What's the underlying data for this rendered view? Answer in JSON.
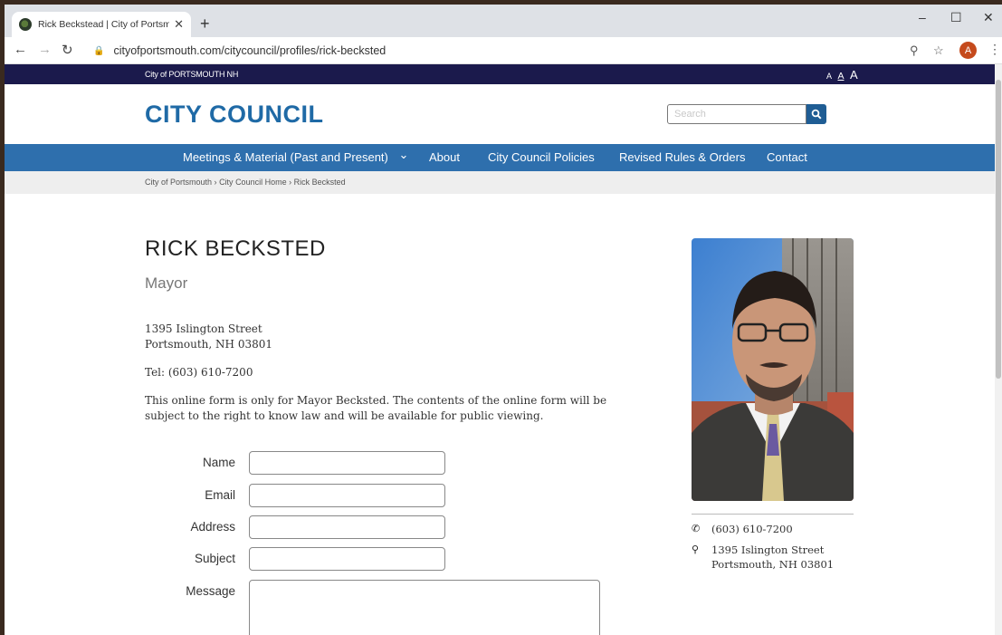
{
  "browser": {
    "tab_title": "Rick Beckstead | City of Portsmouth",
    "url": "cityofportsmouth.com/citycouncil/profiles/rick-becksted",
    "profile_initial": "A"
  },
  "topbar": {
    "site_name": "City of PORTSMOUTH NH",
    "text_sizes": [
      "A",
      "A",
      "A"
    ]
  },
  "header": {
    "title": "CITY COUNCIL",
    "search_placeholder": "Search"
  },
  "nav": {
    "items": [
      "Meetings & Material (Past and Present)",
      "About",
      "City Council Policies",
      "Revised Rules & Orders",
      "Contact"
    ],
    "dropdown_glyph": "⌄"
  },
  "breadcrumb": {
    "items": [
      "City of Portsmouth",
      "City Council Home",
      "Rick Becksted"
    ],
    "separator": "›"
  },
  "profile": {
    "name": "RICK BECKSTED",
    "role": "Mayor",
    "address_line1": "1395 Islington Street",
    "address_line2": "Portsmouth, NH 03801",
    "tel": "Tel: (603) 610-7200",
    "notice": "This online form is only for Mayor Becksted. The contents of the online form will be subject to the right to know law and will be available for public viewing."
  },
  "form": {
    "labels": [
      "Name",
      "Email",
      "Address",
      "Subject",
      "Message"
    ]
  },
  "sidebar": {
    "phone": "(603) 610-7200",
    "address_line1": "1395 Islington Street",
    "address_line2": "Portsmouth, NH 03801"
  },
  "colors": {
    "brand_blue": "#1f6aa6",
    "nav_blue": "#2e6fad",
    "topbar_navy": "#1b1a4c"
  }
}
